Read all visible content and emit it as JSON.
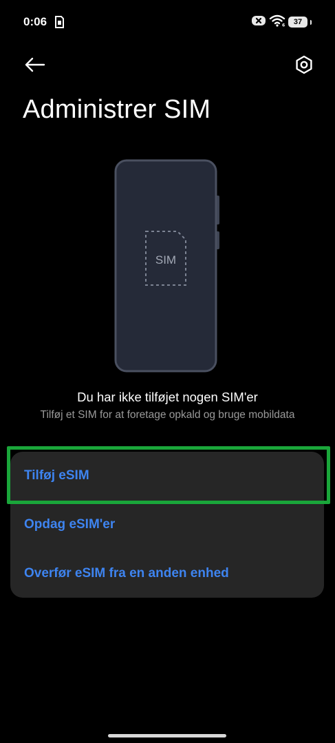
{
  "status_bar": {
    "time": "0:06",
    "battery_level": "37",
    "icons": [
      "sim-card-icon",
      "x-notification-icon",
      "wifi-icon",
      "battery-icon"
    ]
  },
  "header": {
    "title": "Administrer SIM",
    "back_icon": "arrow-left-icon",
    "settings_icon": "gear-icon"
  },
  "illustration": {
    "sim_label": "SIM"
  },
  "empty_state": {
    "title": "Du har ikke tilføjet nogen SIM'er",
    "subtitle": "Tilføj et SIM for at foretage opkald og bruge mobildata"
  },
  "options": [
    {
      "label": "Tilføj eSIM"
    },
    {
      "label": "Opdag eSIM'er"
    },
    {
      "label": "Overfør eSIM fra en anden enhed"
    }
  ],
  "colors": {
    "background": "#000000",
    "card": "#262626",
    "accent": "#3e84f0",
    "highlight": "#1aa63a",
    "phone_body": "#252a38",
    "phone_border": "#4a5060"
  }
}
